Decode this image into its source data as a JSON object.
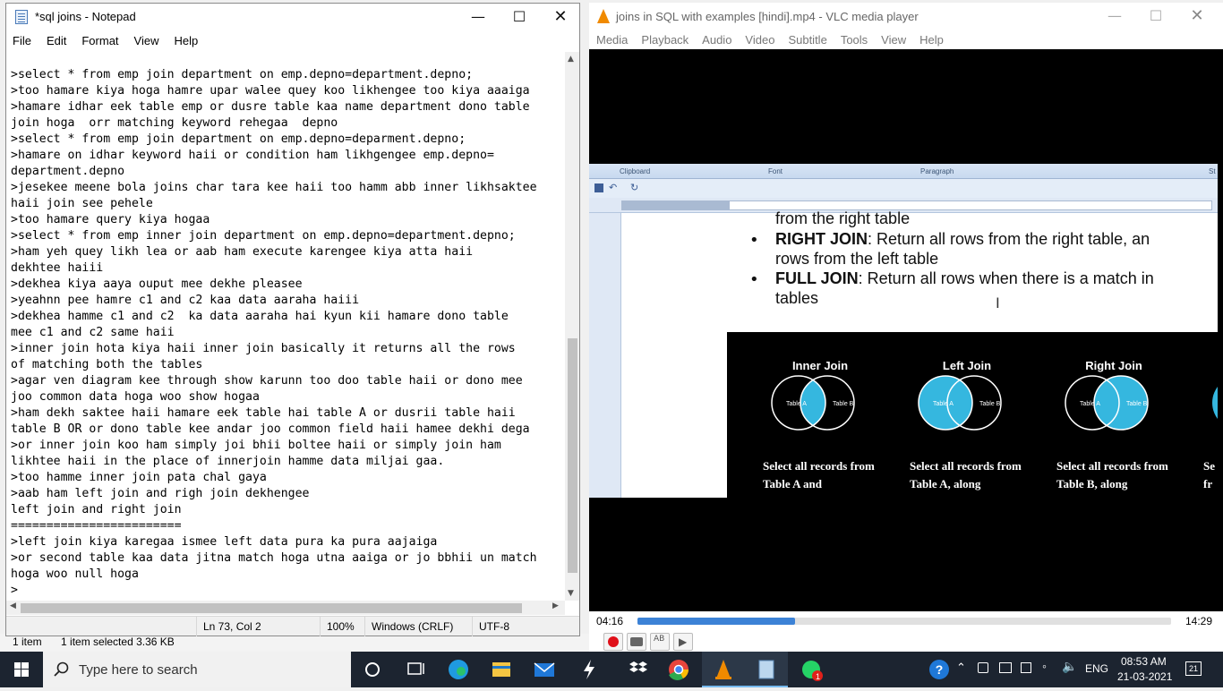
{
  "explorer": {
    "items": "1 item",
    "selected": "1 item selected  3.36 KB"
  },
  "notepad": {
    "title": "*sql joins - Notepad",
    "menu": [
      "File",
      "Edit",
      "Format",
      "View",
      "Help"
    ],
    "content": ">select * from emp join department on emp.depno=department.depno;\n>too hamare kiya hoga hamre upar walee quey koo likhengee too kiya aaaiga\n>hamare idhar eek table emp or dusre table kaa name department dono table\njoin hoga  orr matching keyword rehegaa  depno\n>select * from emp join department on emp.depno=deparment.depno;\n>hamare on idhar keyword haii or condition ham likhgengee emp.depno=\ndepartment.depno\n>jesekee meene bola joins char tara kee haii too hamm abb inner likhsaktee\nhaii join see pehele\n>too hamare query kiya hogaa\n>select * from emp inner join department on emp.depno=department.depno;\n>ham yeh quey likh lea or aab ham execute karengee kiya atta haii\ndekhtee haiii\n>dekhea kiya aaya ouput mee dekhe pleasee\n>yeahnn pee hamre c1 and c2 kaa data aaraha haiii\n>dekhea hamme c1 and c2  ka data aaraha hai kyun kii hamare dono table\nmee c1 and c2 same haii\n>inner join hota kiya haii inner join basically it returns all the rows\nof matching both the tables\n>agar ven diagram kee through show karunn too doo table haii or dono mee\njoo common data hoga woo show hogaa\n>ham dekh saktee haii hamare eek table hai table A or dusrii table haii\ntable B OR or dono table kee andar joo common field haii hamee dekhi dega\n>or inner join koo ham simply joi bhii boltee haii or simply join ham\nlikhtee haii in the place of innerjoin hamme data miljai gaa.\n>too hamme inner join pata chal gaya\n>aab ham left join and righ join dekhengee\nleft join and right join\n========================\n>left join kiya karegaa ismee left data pura ka pura aajaiga\n>or second table kaa data jitna match hoga utna aaiga or jo bbhii un match\nhoga woo null hoga\n>",
    "status": {
      "position": "Ln 73, Col 2",
      "zoom": "100%",
      "eol": "Windows (CRLF)",
      "encoding": "UTF-8"
    }
  },
  "vlc": {
    "title": "joins in SQL with examples [hindi].mp4 - VLC media player",
    "menu": [
      "Media",
      "Playback",
      "Audio",
      "Video",
      "Subtitle",
      "Tools",
      "View",
      "Help"
    ],
    "time_elapsed": "04:16",
    "time_total": "14:29",
    "progress": 0.2946,
    "video": {
      "ribbon_groups": [
        "Clipboard",
        "Font",
        "Paragraph",
        "St"
      ],
      "doc_lines": {
        "line0": "from the right table",
        "right_join_bold": "RIGHT JOIN",
        "right_join_rest": ": Return all rows from the right table, an",
        "right_join_line2": "rows from the left table",
        "full_join_bold": "FULL JOIN",
        "full_join_rest": ": Return all rows when there is a match in",
        "full_join_line2": "tables"
      },
      "venn": [
        {
          "title": "Inner Join",
          "a": "Table A",
          "b": "Table B",
          "desc": "Select all records from Table A and"
        },
        {
          "title": "Left Join",
          "a": "Table A",
          "b": "Table B",
          "desc": "Select all records from Table A, along"
        },
        {
          "title": "Right Join",
          "a": "Table A",
          "b": "Table B",
          "desc": "Select all records from Table B, along"
        },
        {
          "title": "",
          "a": "",
          "b": "",
          "desc": "Se fr"
        }
      ]
    }
  },
  "taskbar": {
    "search_placeholder": "Type here to search",
    "whatsapp_badge": "1",
    "lang": "ENG",
    "time": "08:53 AM",
    "date": "21-03-2021",
    "notif_count": "21"
  },
  "colors": {
    "accent": "#3c82d6",
    "venn_fill": "#35b7df",
    "taskbar": "#1c2430"
  }
}
